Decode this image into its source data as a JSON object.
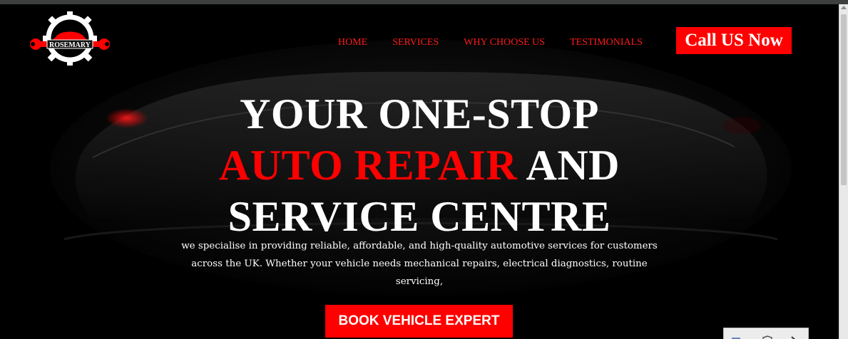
{
  "logo": {
    "text": "ROSEMARY"
  },
  "nav": {
    "items": [
      {
        "label": "HOME"
      },
      {
        "label": "SERVICES"
      },
      {
        "label": "WHY CHOOSE US"
      },
      {
        "label": "TESTIMONIALS"
      }
    ]
  },
  "cta": {
    "call_label": "Call US Now"
  },
  "hero": {
    "line1": "YOUR ONE-STOP",
    "line2_red": "AUTO REPAIR",
    "line2_white": " AND",
    "line3": "SERVICE CENTRE",
    "description": "we specialise in providing reliable, affordable, and high-quality automotive services for customers across the UK. Whether your vehicle needs mechanical repairs, electrical diagnostics, routine servicing,",
    "book_label": "BOOK VEHICLE EXPERT"
  },
  "colors": {
    "accent": "#ff0000",
    "background": "#000000",
    "text": "#ffffff"
  },
  "icons": [
    "gear-icon",
    "wrench-icon",
    "car-icon"
  ]
}
